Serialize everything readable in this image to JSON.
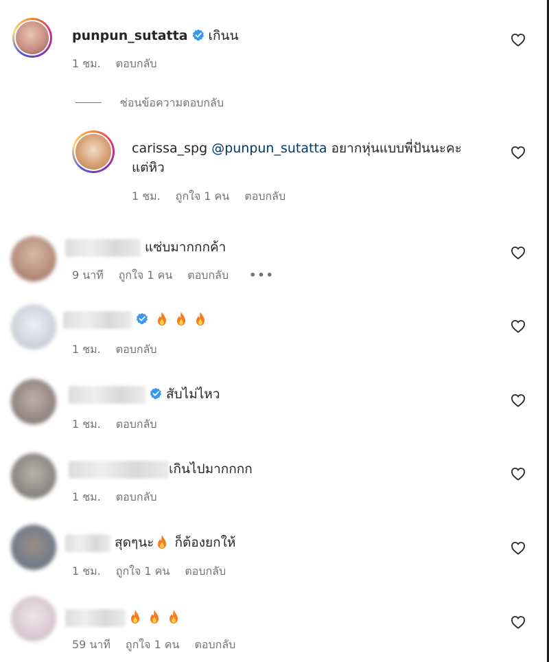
{
  "comments": [
    {
      "username": "punpun_sutatta",
      "text": "เกินน",
      "time": "1 ชม.",
      "reply": "ตอบกลับ"
    },
    {
      "username": "carissa_spg",
      "mention": "@punpun_sutatta",
      "text": "อยากหุ่นแบบพี่ปันนะคะ",
      "text2": "แต่หิว",
      "time": "1 ชม.",
      "likes": "ถูกใจ 1 คน",
      "reply": "ตอบกลับ"
    },
    {
      "text": "แซ่บมากกกค้า",
      "time": "9 นาที",
      "likes": "ถูกใจ 1 คน",
      "reply": "ตอบกลับ",
      "more": "•••"
    },
    {
      "time": "1 ชม.",
      "reply": "ตอบกลับ"
    },
    {
      "text": "สับไม่ไหว",
      "time": "1 ชม.",
      "reply": "ตอบกลับ"
    },
    {
      "text": "เกินไปมากกกก",
      "time": "1 ชม.",
      "reply": "ตอบกลับ"
    },
    {
      "text": "สุดๆนะ",
      "text2": "ก็ต้องยกให้",
      "time": "1 ชม.",
      "likes": "ถูกใจ 1 คน",
      "reply": "ตอบกลับ"
    },
    {
      "time": "59 นาที",
      "likes": "ถูกใจ 1 คน",
      "reply": "ตอบกลับ"
    }
  ],
  "hide_replies": "ซ่อนข้อความตอบกลับ",
  "colors": {
    "verified": "#3897f0",
    "flame": "#f77a1c",
    "meta": "#737373",
    "mention": "#00376b"
  }
}
